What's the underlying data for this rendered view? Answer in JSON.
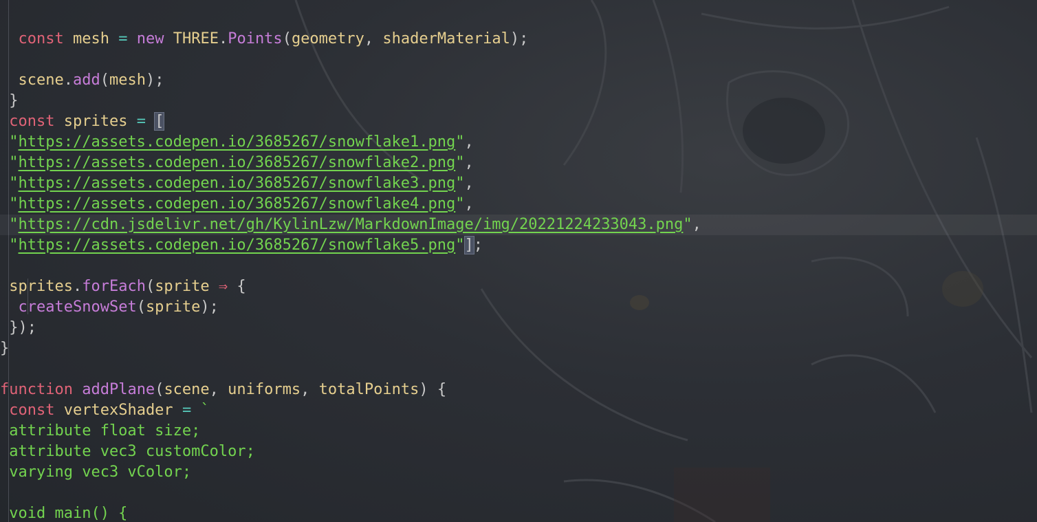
{
  "theme": {
    "background": "#2b2e34",
    "keyword": "#e06377",
    "identifier": "#e6cf8f",
    "function": "#c77dd9",
    "operator": "#55c7b8",
    "string": "#73d44f",
    "punctuation": "#c9c9c9"
  },
  "editor": {
    "lines": [
      [],
      [
        [
          "  ",
          "pu"
        ],
        [
          "const",
          "kw"
        ],
        [
          " ",
          "pu"
        ],
        [
          "mesh",
          "id"
        ],
        [
          " ",
          "pu"
        ],
        [
          "=",
          "op"
        ],
        [
          " ",
          "pu"
        ],
        [
          "new",
          "fn"
        ],
        [
          " ",
          "pu"
        ],
        [
          "THREE",
          "id"
        ],
        [
          ".",
          "pu"
        ],
        [
          "Points",
          "fn"
        ],
        [
          "(",
          "pu"
        ],
        [
          "geometry",
          "id"
        ],
        [
          ", ",
          "pu"
        ],
        [
          "shaderMaterial",
          "id"
        ],
        [
          ");",
          "pu"
        ]
      ],
      [],
      [
        [
          "  ",
          "pu"
        ],
        [
          "scene",
          "id"
        ],
        [
          ".",
          "pu"
        ],
        [
          "add",
          "fn"
        ],
        [
          "(",
          "pu"
        ],
        [
          "mesh",
          "id"
        ],
        [
          ");",
          "pu"
        ]
      ],
      [
        [
          " }",
          "pu"
        ]
      ],
      [
        [
          " ",
          "pu"
        ],
        [
          "const",
          "kw"
        ],
        [
          " ",
          "pu"
        ],
        [
          "sprites",
          "id"
        ],
        [
          " ",
          "pu"
        ],
        [
          "=",
          "op"
        ],
        [
          " ",
          "pu"
        ],
        [
          "[",
          "br"
        ]
      ],
      [
        [
          " \"",
          "str"
        ],
        [
          "https://assets.codepen.io/3685267/snowflake1.png",
          "url"
        ],
        [
          "\"",
          "str"
        ],
        [
          ",",
          "pu"
        ]
      ],
      [
        [
          " \"",
          "str"
        ],
        [
          "https://assets.codepen.io/3685267/snowflake2.png",
          "url"
        ],
        [
          "\"",
          "str"
        ],
        [
          ",",
          "pu"
        ]
      ],
      [
        [
          " \"",
          "str"
        ],
        [
          "https://assets.codepen.io/3685267/snowflake3.png",
          "url"
        ],
        [
          "\"",
          "str"
        ],
        [
          ",",
          "pu"
        ]
      ],
      [
        [
          " \"",
          "str"
        ],
        [
          "https://assets.codepen.io/3685267/snowflake4.png",
          "url"
        ],
        [
          "\"",
          "str"
        ],
        [
          ",",
          "pu"
        ]
      ],
      [
        [
          " \"",
          "str"
        ],
        [
          "https://cdn.jsdelivr.net/gh/KylinLzw/MarkdownImage/img/20221224233043.png",
          "url"
        ],
        [
          "\"",
          "str"
        ],
        [
          ",",
          "pu"
        ]
      ],
      [
        [
          " \"",
          "str"
        ],
        [
          "https://assets.codepen.io/3685267/snowflake5.png",
          "url"
        ],
        [
          "\"",
          "str"
        ],
        [
          "]",
          "br"
        ],
        [
          ";",
          "pu"
        ]
      ],
      [],
      [
        [
          " ",
          "pu"
        ],
        [
          "sprites",
          "id"
        ],
        [
          ".",
          "pu"
        ],
        [
          "forEach",
          "fn"
        ],
        [
          "(",
          "pu"
        ],
        [
          "sprite",
          "id"
        ],
        [
          " ",
          "pu"
        ],
        [
          "⇒",
          "ar"
        ],
        [
          " {",
          "pu"
        ]
      ],
      [
        [
          "  ",
          "pu"
        ],
        [
          "createSnowSet",
          "fn"
        ],
        [
          "(",
          "pu"
        ],
        [
          "sprite",
          "id"
        ],
        [
          ");",
          "pu"
        ]
      ],
      [
        [
          " });",
          "pu"
        ]
      ],
      [
        [
          "}",
          "pu"
        ]
      ],
      [],
      [
        [
          "function",
          "kw"
        ],
        [
          " ",
          "pu"
        ],
        [
          "addPlane",
          "fn"
        ],
        [
          "(",
          "pu"
        ],
        [
          "scene",
          "id"
        ],
        [
          ", ",
          "pu"
        ],
        [
          "uniforms",
          "id"
        ],
        [
          ", ",
          "pu"
        ],
        [
          "totalPoints",
          "id"
        ],
        [
          ") {",
          "pu"
        ]
      ],
      [
        [
          " ",
          "pu"
        ],
        [
          "const",
          "kw"
        ],
        [
          " ",
          "pu"
        ],
        [
          "vertexShader",
          "id"
        ],
        [
          " ",
          "pu"
        ],
        [
          "=",
          "op"
        ],
        [
          " ",
          "pu"
        ],
        [
          "`",
          "str"
        ]
      ],
      [
        [
          " attribute float size;",
          "str"
        ]
      ],
      [
        [
          " attribute vec3 customColor;",
          "str"
        ]
      ],
      [
        [
          " varying vec3 vColor;",
          "str"
        ]
      ],
      [],
      [
        [
          " void main() {",
          "str"
        ]
      ]
    ],
    "highlighted_line": 10
  }
}
